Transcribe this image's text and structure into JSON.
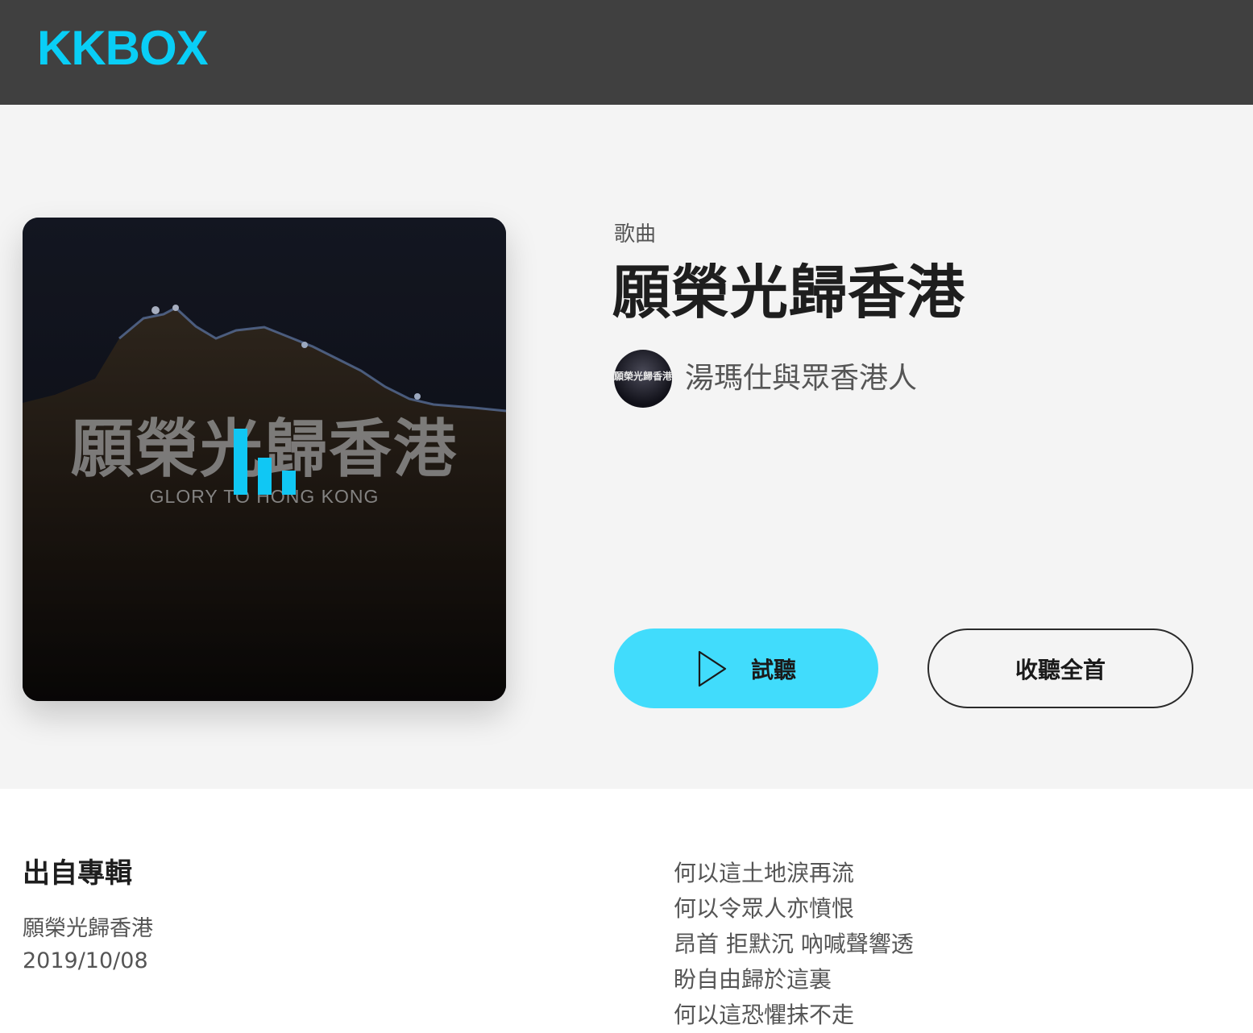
{
  "header": {
    "logo_text": "KKBOX",
    "logo_color": "#09cef6",
    "background": "#404040"
  },
  "cover": {
    "title_overlay": "願榮光歸香港",
    "subtitle_overlay": "GLORY TO HONG KONG",
    "now_playing_icon": "equalizer-bars-icon",
    "accent": "#10c7f4"
  },
  "song": {
    "type_label": "歌曲",
    "title": "願榮光歸香港",
    "artist": "湯瑪仕與眾香港人",
    "artist_avatar_text": "願榮光歸香港"
  },
  "actions": {
    "preview_label": "試聽",
    "preview_icon": "play-icon",
    "preview_color": "#41dcfc",
    "full_label": "收聽全首"
  },
  "album": {
    "heading": "出自專輯",
    "name": "願榮光歸香港",
    "release_date": "2019/10/08"
  },
  "lyrics": [
    "何以這土地淚再流",
    "何以令眾人亦憤恨",
    "昂首 拒默沉 吶喊聲響透",
    "盼自由歸於這裏",
    "何以這恐懼抹不走"
  ]
}
